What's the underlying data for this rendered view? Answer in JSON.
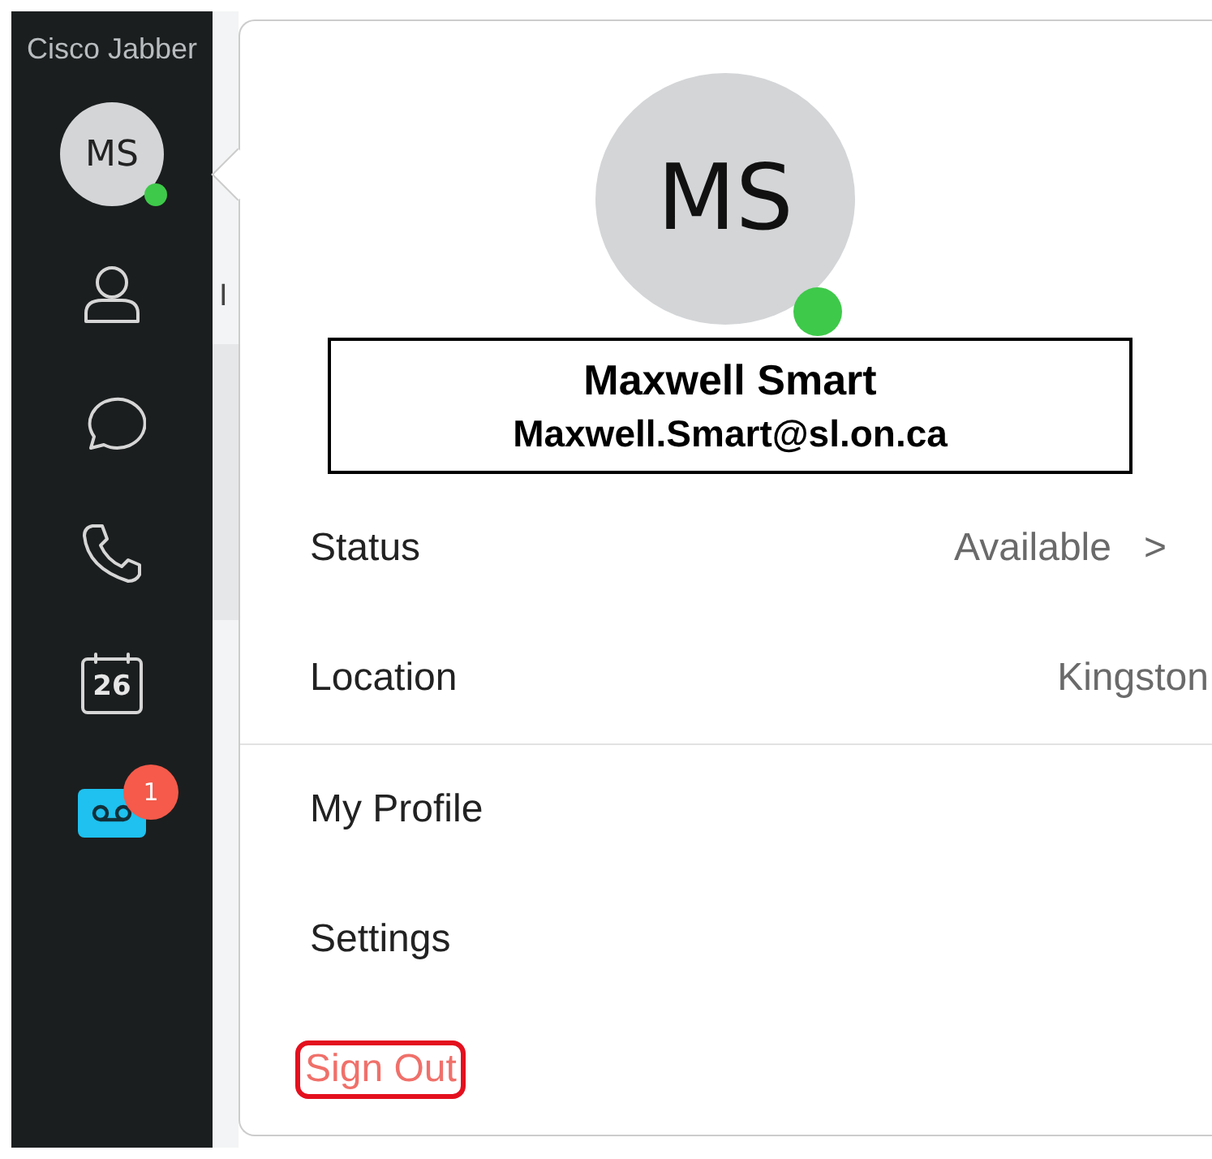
{
  "app": {
    "title": "Cisco Jabber"
  },
  "sidebar": {
    "avatar": {
      "initials": "MS",
      "online": true
    },
    "nav": [
      {
        "kind": "contacts"
      },
      {
        "kind": "chats"
      },
      {
        "kind": "calls"
      },
      {
        "kind": "meetings",
        "label": "26"
      },
      {
        "kind": "voicemail",
        "badge": "1"
      }
    ]
  },
  "background": {
    "text": "I"
  },
  "profile_popup": {
    "avatar": {
      "initials": "MS",
      "online": true
    },
    "name": "Maxwell Smart",
    "email": "Maxwell.Smart@sl.on.ca",
    "identity_boxed": true,
    "fields": [
      {
        "label": "Status",
        "value": "Available",
        "chevron": ">"
      },
      {
        "label": "Location",
        "value": "Kingston"
      }
    ],
    "menu": [
      {
        "label": "My Profile",
        "kind": "normal",
        "highlighted": false
      },
      {
        "label": "Settings",
        "kind": "normal",
        "highlighted": false
      },
      {
        "label": "Sign Out",
        "kind": "danger",
        "highlighted": true
      }
    ]
  }
}
